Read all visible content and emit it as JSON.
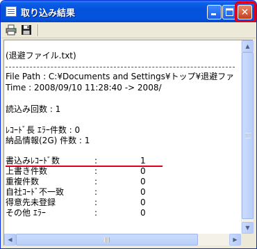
{
  "window": {
    "title": "取り込み結果",
    "controls": {
      "minimize": "minimize",
      "maximize": "maximize",
      "close": "✕"
    }
  },
  "toolbar": {
    "print_icon": "printer-icon",
    "save_icon": "floppy-disk-icon"
  },
  "log": {
    "line_source": "(退避ファイル.txt)",
    "line_path": "File Path : C:¥Documents and Settings¥トップ¥退避ファ",
    "line_time": "Time : 2008/09/10 11:28:40 -> 2008/",
    "line_read_count": "読込み回数 : 1",
    "line_length_errors": "ﾚｺｰﾄﾞ長 ｴﾗｰ件数 : 0",
    "line_delivery_count": "納品情報(2G) 件数 : 1",
    "rows": [
      {
        "label": "書込みﾚｺｰﾄﾞ数",
        "colon": ":",
        "value": "1"
      },
      {
        "label": "上書き件数",
        "colon": ":",
        "value": "0"
      },
      {
        "label": "重複件数",
        "colon": ":",
        "value": "0"
      },
      {
        "label": "自社ｺｰﾄﾞ不一致",
        "colon": ":",
        "value": "0"
      },
      {
        "label": "得意先未登録",
        "colon": ":",
        "value": "0"
      },
      {
        "label": "その他 ｴﾗｰ",
        "colon": ":",
        "value": "0"
      }
    ]
  },
  "colors": {
    "highlight": "#e0001a",
    "titlebar": "#0453dc"
  }
}
